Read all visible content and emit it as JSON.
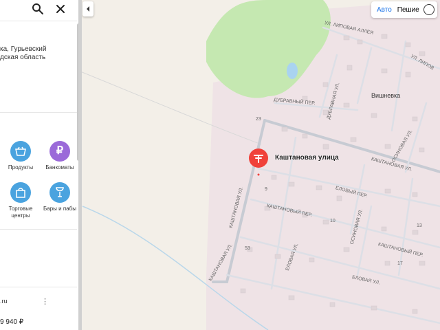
{
  "search": {
    "search_icon": "search-icon",
    "close_icon": "close-icon"
  },
  "address": {
    "line1": "ка, Гурьевский",
    "line2": "дская область"
  },
  "categories": [
    {
      "label": "Продукты",
      "icon": "basket-icon",
      "color": "#4aa3df"
    },
    {
      "label": "Банкоматы",
      "icon": "ruble-icon",
      "color": "#9b6ad9"
    },
    {
      "label": "Торговые центры",
      "icon": "shopping-bag-icon",
      "color": "#4aa3df"
    },
    {
      "label": "Бары и пабы",
      "icon": "wine-glass-icon",
      "color": "#4aa3df"
    }
  ],
  "ad": {
    "title": ".ru",
    "price": "9 940 ₽",
    "menu_icon": "more-vertical-icon"
  },
  "modes": {
    "car": "Авто",
    "walk": "Пешие",
    "active": "car"
  },
  "map": {
    "pin_label": "Каштановая улица",
    "place_label": "Вишневка",
    "streets": {
      "lipovaya_alley": "УЛ. ЛИПОВАЯ АЛЛЕЯ",
      "lipovaya": "УЛ. ЛИПОВ",
      "dubravnaya_st": "ДУБРАВНАЯ УЛ.",
      "dubravny_per": "ДУБРАВНЫЙ ПЕР.",
      "osinovaya_top": "ОСИНОВАЯ УЛ.",
      "kashtanovaya_top": "КАШТАНОВАЯ УЛ.",
      "eloviy_per": "ЕЛОВЫЙ ПЕР.",
      "kashtanovy_per": "КАШТАНОВЫЙ ПЕР.",
      "osinovaya_mid": "ОСИНОВАЯ УЛ.",
      "kashtanovaya_left": "КАШТАНОВАЯ УЛ.",
      "kashtanovy_per2": "КАШТАНОВЫЙ ПЕР.",
      "kashtanovaya_bl": "КАШТАНОВАЯ УЛ.",
      "elovaya_1": "ЕЛОВАЯ УЛ.",
      "elovaya_2": "ЕЛОВАЯ УЛ."
    },
    "numbers": [
      "23",
      "10",
      "13",
      "17",
      "9",
      "53"
    ]
  }
}
